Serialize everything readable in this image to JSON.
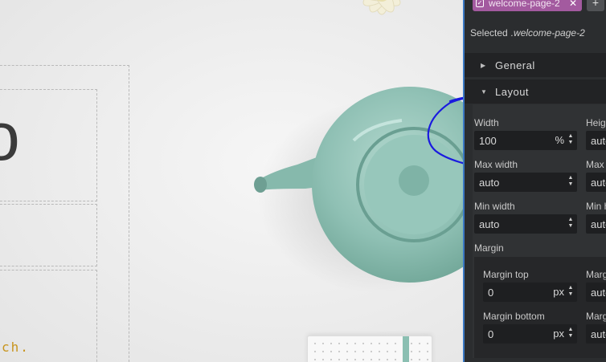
{
  "canvas": {
    "big_letter": "o",
    "accent_text": "ch."
  },
  "panel": {
    "tag": {
      "label": "welcome-page-2",
      "close": "✕",
      "add": "+"
    },
    "selected": {
      "prefix": "Selected",
      "value": ".welcome-page-2"
    },
    "sections": {
      "general": "General",
      "layout": "Layout"
    },
    "layout": {
      "width": {
        "label": "Width",
        "value": "100",
        "unit": "%"
      },
      "height": {
        "label": "Height",
        "value": "auto"
      },
      "max_width": {
        "label": "Max width",
        "value": "auto"
      },
      "max_height": {
        "label": "Max height",
        "value": "auto"
      },
      "min_width": {
        "label": "Min width",
        "value": "auto"
      },
      "min_height": {
        "label": "Min height",
        "value": "auto"
      },
      "margin": {
        "label": "Margin",
        "margin_top": {
          "label": "Margin top",
          "value": "0",
          "unit": "px"
        },
        "margin_right": {
          "label": "Margin right",
          "value": "auto"
        },
        "margin_bottom": {
          "label": "Margin bottom",
          "value": "0",
          "unit": "px"
        },
        "margin_left": {
          "label": "Margin left",
          "value": "auto"
        }
      }
    }
  },
  "colors": {
    "panel_bg": "#2b2d2f",
    "tag_bg": "#a35a9f",
    "annotation": "#1a1adf",
    "teapot": "#8fc0b4",
    "accent_text": "#c8941c"
  },
  "icons": {
    "spinner": "up-down-arrows-icon",
    "collapsed": "triangle-right-icon",
    "expanded": "triangle-down-icon",
    "check": "checkbox-icon",
    "close": "close-icon",
    "add": "plus-icon"
  }
}
